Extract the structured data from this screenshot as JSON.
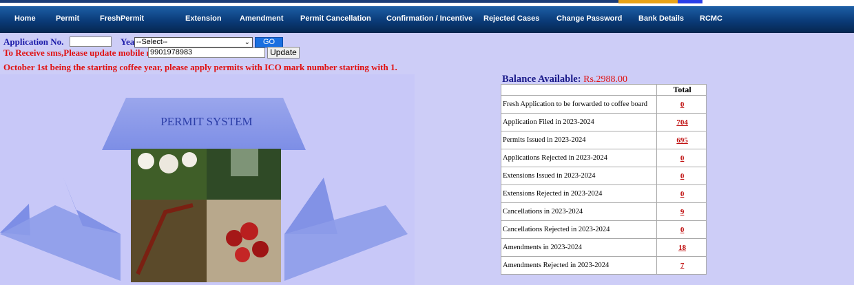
{
  "nav": {
    "items": [
      "Home",
      "Permit",
      "FreshPermit",
      "Extension",
      "Amendment",
      "Permit Cancellation",
      "Confirmation / Incentive",
      "Rejected Cases",
      "Change Password",
      "Bank Details",
      "RCMC"
    ]
  },
  "form": {
    "app_no_label": "Application No.",
    "app_no_value": "",
    "year_label": "Year",
    "year_selected": "--Select--",
    "go_label": "GO",
    "sms_label": "To Receive sms,Please update mobile no",
    "mobile_value": "9901978983",
    "update_label": "Update"
  },
  "notice": "October 1st being the starting coffee year, please apply permits with ICO mark number starting with 1.",
  "illustration": {
    "title": "PERMIT SYSTEM"
  },
  "balance": {
    "label": "Balance Available:",
    "amount": "Rs.2988.00"
  },
  "stats": {
    "header_total": "Total",
    "rows": [
      {
        "label": "Fresh Application to be forwarded to coffee board",
        "count": "0"
      },
      {
        "label": "Application Filed in 2023-2024",
        "count": "704"
      },
      {
        "label": "Permits Issued in 2023-2024",
        "count": "695"
      },
      {
        "label": "Applications Rejected in 2023-2024",
        "count": "0"
      },
      {
        "label": "Extensions Issued in 2023-2024",
        "count": "0"
      },
      {
        "label": "Extensions Rejected in 2023-2024",
        "count": "0"
      },
      {
        "label": "Cancellations in 2023-2024",
        "count": "9"
      },
      {
        "label": "Cancellations Rejected in 2023-2024",
        "count": "0"
      },
      {
        "label": "Amendments in 2023-2024",
        "count": "18"
      },
      {
        "label": "Amendments Rejected in 2023-2024",
        "count": "7"
      }
    ]
  },
  "colors": {
    "page_bg": "#cdcdf7",
    "nav_bg": "#0a3b78",
    "accent_red": "#e01010",
    "label_blue": "#1a1aa8"
  }
}
